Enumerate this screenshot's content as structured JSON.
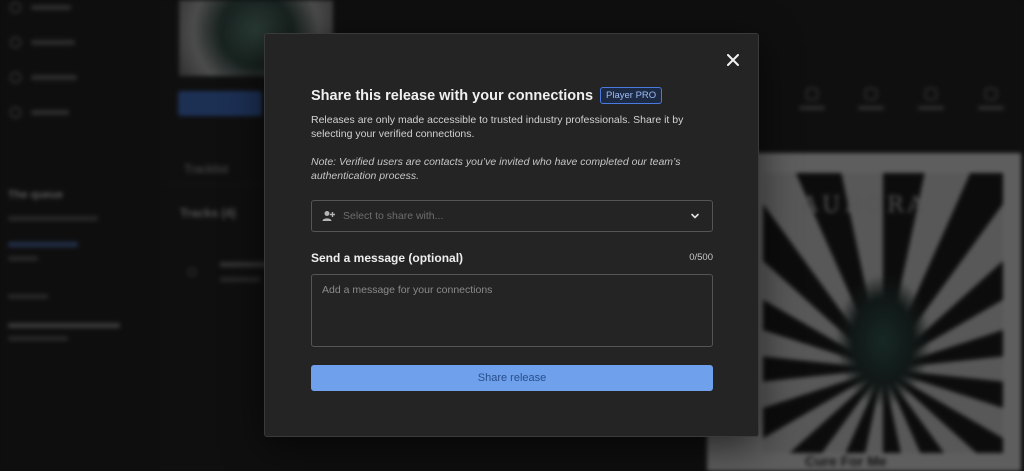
{
  "background": {
    "sidebar": {
      "section_title": "The queue"
    },
    "tabs": [
      "Tracklist"
    ],
    "tracks_title": "Tracks (4)",
    "artwork_title": "AURORA",
    "artwork_caption": "Cure For Me"
  },
  "modal": {
    "title": "Share this release with your connections",
    "badge": "Player PRO",
    "description": "Releases are only made accessible to trusted industry professionals. Share it by selecting your verified connections.",
    "note": "Note: Verified users are contacts you’ve invited who have completed our team’s authentication process.",
    "select": {
      "placeholder": "Select to share with..."
    },
    "message": {
      "label": "Send a message (optional)",
      "count": "0/500",
      "placeholder": "Add a message for your connections",
      "value": ""
    },
    "share_button": "Share release",
    "icons": {
      "close": "close-icon",
      "person_add": "person-add-icon",
      "chevron": "chevron-down-icon"
    }
  },
  "colors": {
    "accent": "#6ea0ec",
    "modal_bg": "#242424",
    "badge_border": "#4a7ae0"
  }
}
